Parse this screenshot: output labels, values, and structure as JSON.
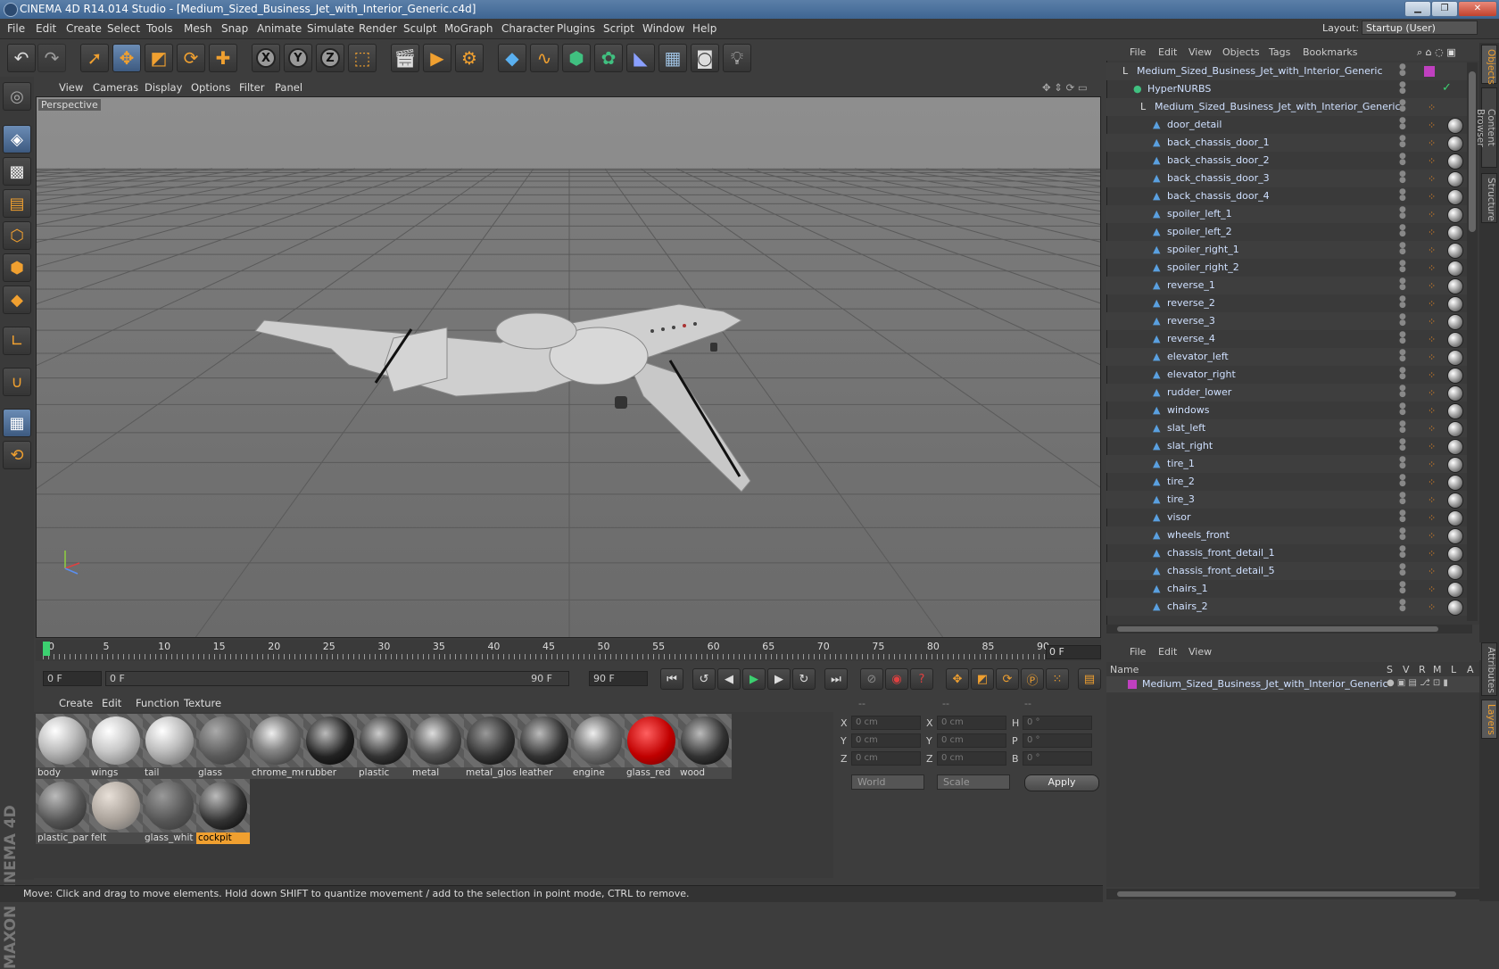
{
  "window": {
    "title": "CINEMA 4D R14.014 Studio - [Medium_Sized_Business_Jet_with_Interior_Generic.c4d]",
    "min": "▁",
    "max": "❐",
    "close": "✕"
  },
  "menubar": {
    "items": [
      "File",
      "Edit",
      "Create",
      "Select",
      "Tools",
      "Mesh",
      "Snap",
      "Animate",
      "Simulate",
      "Render",
      "Sculpt",
      "MoGraph",
      "Character",
      "Plugins",
      "Script",
      "Window",
      "Help"
    ],
    "layout_label": "Layout:",
    "layout_value": "Startup (User)"
  },
  "viewport": {
    "menu": [
      "View",
      "Cameras",
      "Display",
      "Options",
      "Filter",
      "Panel"
    ],
    "label": "Perspective"
  },
  "timeline": {
    "ticks": [
      "0",
      "5",
      "10",
      "15",
      "20",
      "25",
      "30",
      "35",
      "40",
      "45",
      "50",
      "55",
      "60",
      "65",
      "70",
      "75",
      "80",
      "85",
      "90"
    ],
    "current": "0 F",
    "start": "0 F",
    "range_start": "0 F",
    "range_end": "90 F",
    "end": "90 F"
  },
  "materials": {
    "menu": [
      "Create",
      "Edit",
      "Function",
      "Texture"
    ],
    "items": [
      {
        "name": "body"
      },
      {
        "name": "wings"
      },
      {
        "name": "tail"
      },
      {
        "name": "glass"
      },
      {
        "name": "chrome_me"
      },
      {
        "name": "rubber"
      },
      {
        "name": "plastic"
      },
      {
        "name": "metal"
      },
      {
        "name": "metal_glos"
      },
      {
        "name": "leather"
      },
      {
        "name": "engine"
      },
      {
        "name": "glass_red"
      },
      {
        "name": "wood"
      },
      {
        "name": "plastic_par"
      },
      {
        "name": "felt"
      },
      {
        "name": "glass_whit"
      },
      {
        "name": "cockpit"
      }
    ]
  },
  "coords": {
    "headers": [
      "--",
      "--",
      "--"
    ],
    "rows": [
      {
        "a": "X",
        "av": "0 cm",
        "b": "X",
        "bv": "0 cm",
        "c": "H",
        "cv": "0 °"
      },
      {
        "a": "Y",
        "av": "0 cm",
        "b": "Y",
        "bv": "0 cm",
        "c": "P",
        "cv": "0 °"
      },
      {
        "a": "Z",
        "av": "0 cm",
        "b": "Z",
        "bv": "0 cm",
        "c": "B",
        "cv": "0 °"
      }
    ],
    "mode": "World",
    "scale": "Scale",
    "apply": "Apply"
  },
  "status": "Move: Click and drag to move elements. Hold down SHIFT to quantize movement / add to the selection in point mode, CTRL to remove.",
  "object_manager": {
    "menu": [
      "File",
      "Edit",
      "View",
      "Objects",
      "Tags",
      "Bookmarks"
    ],
    "objects": [
      {
        "name": "Medium_Sized_Business_Jet_with_Interior_Generic",
        "level": 0
      },
      {
        "name": "HyperNURBS",
        "level": 1
      },
      {
        "name": "Medium_Sized_Business_Jet_with_Interior_Generic",
        "level": 2
      },
      {
        "name": "door_detail",
        "level": 3
      },
      {
        "name": "back_chassis_door_1",
        "level": 3
      },
      {
        "name": "back_chassis_door_2",
        "level": 3
      },
      {
        "name": "back_chassis_door_3",
        "level": 3
      },
      {
        "name": "back_chassis_door_4",
        "level": 3
      },
      {
        "name": "spoiler_left_1",
        "level": 3
      },
      {
        "name": "spoiler_left_2",
        "level": 3
      },
      {
        "name": "spoiler_right_1",
        "level": 3
      },
      {
        "name": "spoiler_right_2",
        "level": 3
      },
      {
        "name": "reverse_1",
        "level": 3
      },
      {
        "name": "reverse_2",
        "level": 3
      },
      {
        "name": "reverse_3",
        "level": 3
      },
      {
        "name": "reverse_4",
        "level": 3
      },
      {
        "name": "elevator_left",
        "level": 3
      },
      {
        "name": "elevator_right",
        "level": 3
      },
      {
        "name": "rudder_lower",
        "level": 3
      },
      {
        "name": "windows",
        "level": 3
      },
      {
        "name": "slat_left",
        "level": 3
      },
      {
        "name": "slat_right",
        "level": 3
      },
      {
        "name": "tire_1",
        "level": 3
      },
      {
        "name": "tire_2",
        "level": 3
      },
      {
        "name": "tire_3",
        "level": 3
      },
      {
        "name": "visor",
        "level": 3
      },
      {
        "name": "wheels_front",
        "level": 3
      },
      {
        "name": "chassis_front_detail_1",
        "level": 3
      },
      {
        "name": "chassis_front_detail_5",
        "level": 3
      },
      {
        "name": "chairs_1",
        "level": 3
      },
      {
        "name": "chairs_2",
        "level": 3
      }
    ]
  },
  "layer_manager": {
    "menu": [
      "File",
      "Edit",
      "View"
    ],
    "columns": [
      "Name",
      "S",
      "V",
      "R",
      "M",
      "L",
      "A"
    ],
    "row": "Medium_Sized_Business_Jet_with_Interior_Generic"
  },
  "side_tabs": [
    "Objects",
    "Content Browser",
    "Structure",
    "Attributes",
    "Layers"
  ],
  "colors": {
    "accent": "#f0a030",
    "selection": "#6b8cb5",
    "layer_color": "#c040c0"
  }
}
